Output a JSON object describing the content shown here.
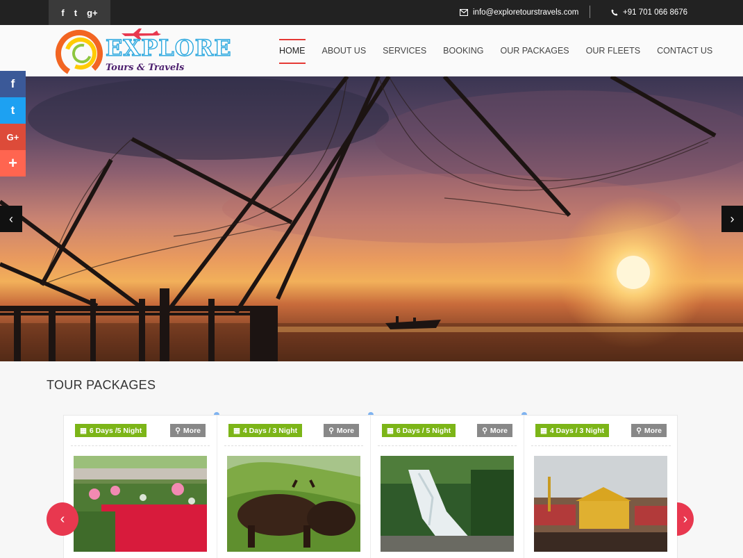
{
  "topbar": {
    "social_icons": [
      "facebook-icon",
      "twitter-icon",
      "google-plus-icon"
    ],
    "social_glyphs": [
      "f",
      "t",
      "g+"
    ],
    "email": "info@exploretourstravels.com",
    "phone": "+91 701 066 8676"
  },
  "logo": {
    "title": "EXPLORE",
    "subtitle": "Tours & Travels"
  },
  "nav": {
    "items": [
      "HOME",
      "ABOUT US",
      "SERVICES",
      "BOOKING",
      "OUR PACKAGES",
      "OUR FLEETS",
      "CONTACT US"
    ],
    "active": "HOME"
  },
  "side_share": {
    "items": [
      {
        "icon": "facebook-icon",
        "glyph": "f",
        "color": "#3b5998"
      },
      {
        "icon": "twitter-icon",
        "glyph": "t",
        "color": "#1da1f2"
      },
      {
        "icon": "google-plus-icon",
        "glyph": "G+",
        "color": "#dd4b39"
      },
      {
        "icon": "add-more-icon",
        "glyph": "+",
        "color": "#ff6550"
      }
    ]
  },
  "slider": {
    "prev_glyph": "‹",
    "next_glyph": "›"
  },
  "section": {
    "title": "TOUR PACKAGES"
  },
  "packages": [
    {
      "duration": "6 Days /5 Night",
      "more": "More",
      "image": "flower-garden"
    },
    {
      "duration": "4 Days / 3 Night",
      "more": "More",
      "image": "bison-hills"
    },
    {
      "duration": "6 Days / 5 Night",
      "more": "More",
      "image": "waterfall"
    },
    {
      "duration": "4 Days / 3 Night",
      "more": "More",
      "image": "temple"
    }
  ],
  "carousel": {
    "prev_glyph": "‹",
    "next_glyph": "›"
  },
  "colors": {
    "badge_green": "#7cb518",
    "more_gray": "#888888",
    "accent_red": "#e8384f",
    "topbar_bg": "#222222"
  }
}
